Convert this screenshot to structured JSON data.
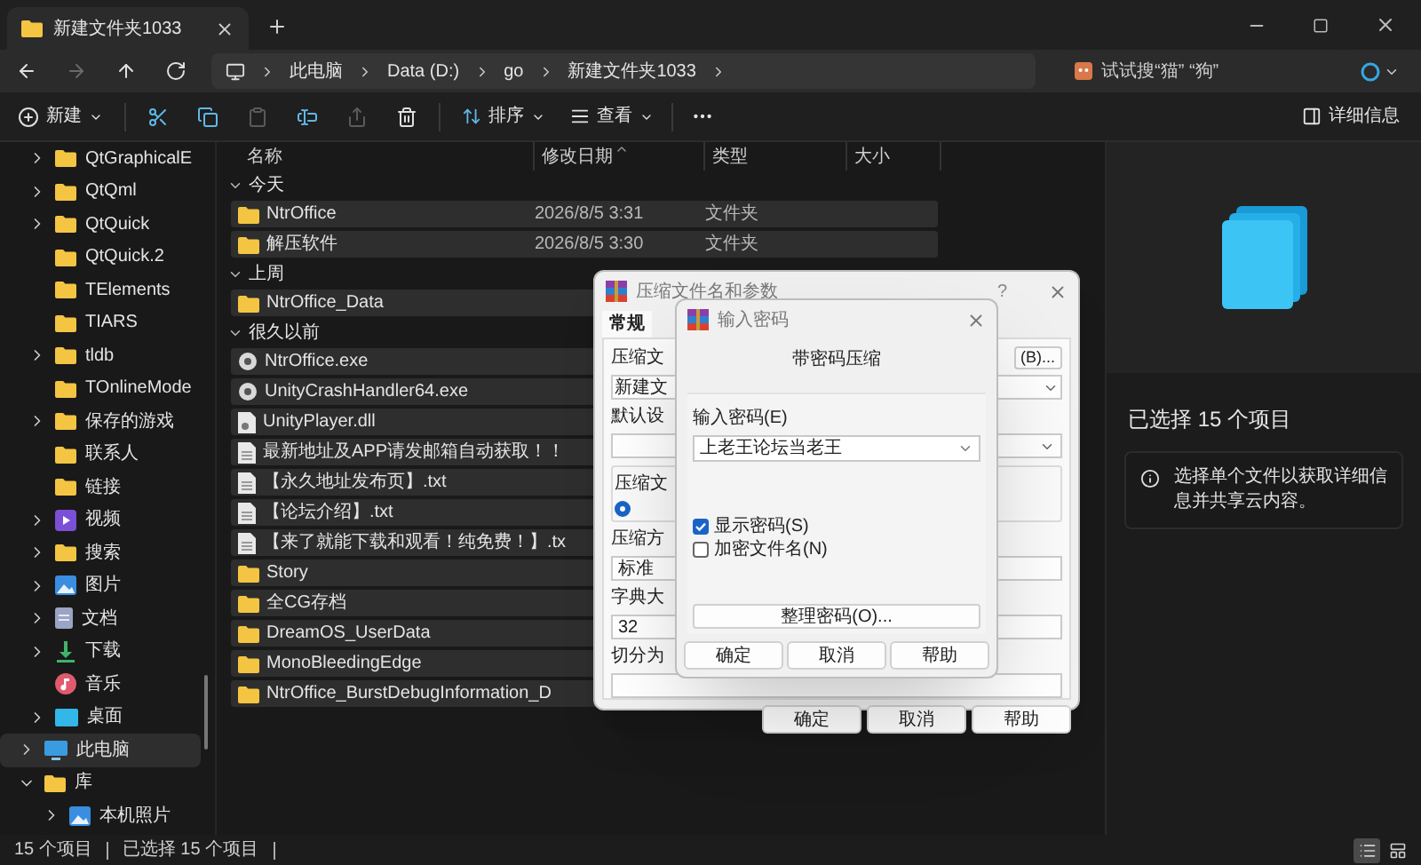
{
  "window": {
    "tab_title": "新建文件夹1033"
  },
  "nav": [
    {
      "kind": "back",
      "disabled": false
    },
    {
      "kind": "forward",
      "disabled": true
    },
    {
      "kind": "up",
      "disabled": false
    },
    {
      "kind": "refresh",
      "disabled": false
    }
  ],
  "address_bar": {
    "breadcrumbs": [
      "此电脑",
      "Data (D:)",
      "go",
      "新建文件夹1033"
    ]
  },
  "search": {
    "placeholder": "试试搜“猫” “狗”"
  },
  "toolbar": {
    "new_label": "新建",
    "actions": [
      {
        "kind": "cut",
        "disabled": false
      },
      {
        "kind": "copy",
        "disabled": false
      },
      {
        "kind": "paste",
        "disabled": true
      },
      {
        "kind": "rename",
        "disabled": false
      },
      {
        "kind": "share",
        "disabled": true
      },
      {
        "kind": "delete",
        "disabled": false
      }
    ],
    "sort_label": "排序",
    "view_label": "查看",
    "details_label": "详细信息"
  },
  "sidebar": {
    "user_folder_items": [
      {
        "label": "QtGraphicalE",
        "kind": "folder",
        "expandable": true,
        "selected": false
      },
      {
        "label": "QtQml",
        "kind": "folder",
        "expandable": true,
        "selected": false
      },
      {
        "label": "QtQuick",
        "kind": "folder",
        "expandable": true,
        "selected": false
      },
      {
        "label": "QtQuick.2",
        "kind": "folder",
        "expandable": false,
        "selected": false
      },
      {
        "label": "TElements",
        "kind": "folder",
        "expandable": false,
        "selected": false
      },
      {
        "label": "TIARS",
        "kind": "folder",
        "expandable": false,
        "selected": false
      },
      {
        "label": "tldb",
        "kind": "folder",
        "expandable": true,
        "selected": false
      },
      {
        "label": "TOnlineMode",
        "kind": "folder",
        "expandable": false,
        "selected": false
      },
      {
        "label": "保存的游戏",
        "kind": "folder",
        "expandable": true,
        "selected": false
      },
      {
        "label": "联系人",
        "kind": "folder",
        "expandable": false,
        "selected": false
      },
      {
        "label": "链接",
        "kind": "folder",
        "expandable": false,
        "selected": false
      },
      {
        "label": "视频",
        "kind": "video",
        "expandable": true,
        "selected": false
      },
      {
        "label": "搜索",
        "kind": "folder",
        "expandable": true,
        "selected": false
      },
      {
        "label": "图片",
        "kind": "picture",
        "expandable": true,
        "selected": false
      },
      {
        "label": "文档",
        "kind": "document",
        "expandable": true,
        "selected": false
      },
      {
        "label": "下载",
        "kind": "download",
        "expandable": true,
        "selected": false
      },
      {
        "label": "音乐",
        "kind": "music",
        "expandable": false,
        "selected": false
      },
      {
        "label": "桌面",
        "kind": "desktop",
        "expandable": true,
        "selected": false
      }
    ],
    "items": [
      {
        "label": "此电脑",
        "kind": "pc",
        "expandable": true,
        "expanded": false,
        "selected": true
      },
      {
        "label": "库",
        "kind": "folder",
        "expandable": true,
        "expanded": true,
        "selected": false,
        "children": [
          {
            "label": "本机照片",
            "kind": "picture",
            "expandable": true,
            "expanded": false,
            "selected": false
          }
        ]
      }
    ]
  },
  "file_list": {
    "columns": [
      "名称",
      "修改日期",
      "类型",
      "大小"
    ],
    "groups": [
      {
        "label": "今天",
        "expanded": true,
        "rows": [
          {
            "name": "NtrOffice",
            "modified": "2026/8/5 3:31",
            "type": "文件夹",
            "kind": "folder",
            "selected": true
          },
          {
            "name": "解压软件",
            "modified": "2026/8/5 3:30",
            "type": "文件夹",
            "kind": "folder",
            "selected": true
          }
        ]
      },
      {
        "label": "上周",
        "expanded": true,
        "rows": [
          {
            "name": "NtrOffice_Data",
            "kind": "folder",
            "selected": true
          }
        ]
      },
      {
        "label": "很久以前",
        "expanded": true,
        "rows": [
          {
            "name": "NtrOffice.exe",
            "kind": "exe",
            "selected": true
          },
          {
            "name": "UnityCrashHandler64.exe",
            "kind": "exe",
            "selected": true
          },
          {
            "name": "UnityPlayer.dll",
            "kind": "dll",
            "selected": true
          },
          {
            "name": "最新地址及APP请发邮箱自动获取！！",
            "kind": "txt",
            "selected": true
          },
          {
            "name": "【永久地址发布页】.txt",
            "kind": "txt",
            "selected": true
          },
          {
            "name": "【论坛介绍】.txt",
            "kind": "txt",
            "selected": true
          },
          {
            "name": "【来了就能下载和观看！纯免费！】.tx",
            "kind": "txt",
            "selected": true
          },
          {
            "name": "Story",
            "kind": "folder",
            "selected": true
          },
          {
            "name": "全CG存档",
            "kind": "folder",
            "selected": true
          },
          {
            "name": "DreamOS_UserData",
            "kind": "folder",
            "selected": true
          },
          {
            "name": "MonoBleedingEdge",
            "kind": "folder",
            "selected": true
          },
          {
            "name": "NtrOffice_BurstDebugInformation_D",
            "kind": "folder",
            "selected": true
          }
        ]
      }
    ]
  },
  "archive_dialog": {
    "title": "压缩文件名和参数",
    "help_label": "?",
    "tabs": [
      {
        "label": "常规",
        "selected": true
      }
    ],
    "archive_name_label": "压缩文",
    "browse_button": "(B)...",
    "archive_name_value": "新建文",
    "profile_label": "默认设",
    "format_label": "压缩文",
    "format_radio_selected": true,
    "method_label": "压缩方",
    "method_value": "标准",
    "dictionary_label": "字典大",
    "dictionary_value": "32",
    "split_label": "切分为",
    "buttons": [
      "确定",
      "取消",
      "帮助"
    ]
  },
  "password_dialog": {
    "title": "输入密码",
    "heading": "带密码压缩",
    "password_label": "输入密码(E)",
    "password_value": "上老王论坛当老王",
    "options": [
      {
        "label": "显示密码(S)",
        "checked": true
      },
      {
        "label": "加密文件名(N)",
        "checked": false
      }
    ],
    "organize_button": "整理密码(O)...",
    "buttons": [
      "确定",
      "取消",
      "帮助"
    ]
  },
  "details_pane": {
    "title": "已选择 15 个项目",
    "info": "选择单个文件以获取详细信息并共享云内容。"
  },
  "status_bar": {
    "item_count": "15 个项目",
    "selected_count": "已选择 15 个项目",
    "views": [
      {
        "kind": "details",
        "selected": true
      },
      {
        "kind": "tiles",
        "selected": false
      }
    ]
  }
}
